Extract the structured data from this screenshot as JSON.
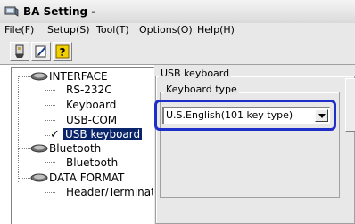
{
  "window": {
    "title": "BA Setting -"
  },
  "menu": [
    {
      "label": "File(F)"
    },
    {
      "label": "Setup(S)"
    },
    {
      "label": "Tool(T)"
    },
    {
      "label": "Options(O)"
    },
    {
      "label": "Help(H)"
    }
  ],
  "toolbar": {
    "buttons": [
      "connect-icon",
      "edit-icon",
      "help-icon"
    ]
  },
  "tree": {
    "items": [
      {
        "label": "INTERFACE",
        "icon": "folder-icon"
      },
      {
        "label": "RS-232C"
      },
      {
        "label": "Keyboard"
      },
      {
        "label": "USB-COM"
      },
      {
        "label": "USB keyboard",
        "checked_glyph": "✓"
      },
      {
        "label": "Bluetooth",
        "icon": "folder-icon"
      },
      {
        "label": "Bluetooth"
      },
      {
        "label": "DATA FORMAT",
        "icon": "folder-icon"
      },
      {
        "label": "Header/Terminato"
      }
    ]
  },
  "panel": {
    "group_title": "USB keyboard",
    "subgroup_title": "Keyboard type",
    "keyboard_type": {
      "selected": "U.S.English(101 key type)"
    }
  },
  "colors": {
    "highlight": "#1e2ec8",
    "selection": "#0a246a",
    "chrome": "#e8e8e8"
  }
}
